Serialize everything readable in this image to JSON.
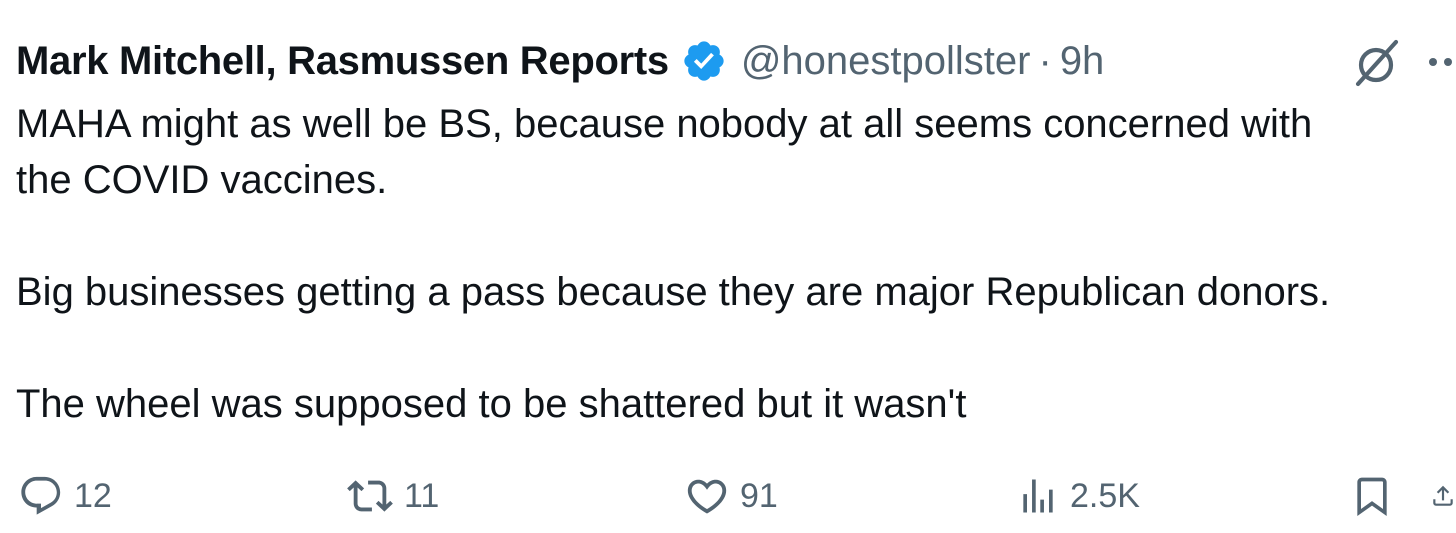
{
  "tweet": {
    "author_name": "Mark Mitchell, Rasmussen Reports",
    "verified": true,
    "handle": "@honestpollster",
    "separator": "·",
    "timestamp": "9h",
    "text_lines": [
      "MAHA might as well be BS, because nobody at all seems concerned with",
      "the COVID vaccines.",
      "Big businesses getting a pass because they are major Republican donors.",
      "The wheel was supposed to be shattered but it wasn't"
    ]
  },
  "actions": {
    "replies": "12",
    "reposts": "11",
    "likes": "91",
    "views": "2.5K"
  },
  "icons": {
    "verified_badge": "verified-badge-icon",
    "grok": "grok-icon",
    "more": "more-icon",
    "reply": "reply-icon",
    "repost": "repost-icon",
    "like": "heart-icon",
    "views": "views-icon",
    "bookmark": "bookmark-icon",
    "share": "share-icon"
  },
  "colors": {
    "text_primary": "#0f1419",
    "text_secondary": "#536471",
    "verified_blue": "#1d9bf0"
  }
}
